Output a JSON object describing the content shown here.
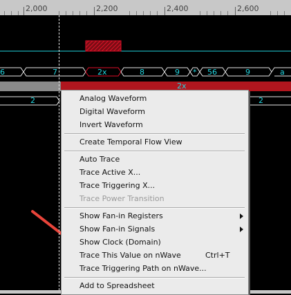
{
  "ruler": {
    "labels": [
      "2,000",
      "2,200",
      "2,400",
      "2,600"
    ]
  },
  "signals": {
    "bus1_values": [
      "6",
      "7",
      "2x",
      "8",
      "9",
      "*",
      "56",
      "9",
      "a"
    ],
    "bus2_label": "2x",
    "bus3_values": [
      "2",
      "2"
    ]
  },
  "menu": {
    "items": [
      {
        "label": "Analog Waveform"
      },
      {
        "label": "Digital Waveform"
      },
      {
        "label": "Invert Waveform"
      },
      {
        "label": "Create Temporal Flow View"
      },
      {
        "label": "Auto Trace"
      },
      {
        "label": "Trace Active X..."
      },
      {
        "label": "Trace Triggering X..."
      },
      {
        "label": "Trace Power Transition",
        "disabled": true
      },
      {
        "label": "Show Fan-in Registers",
        "submenu": true
      },
      {
        "label": "Show Fan-in Signals",
        "submenu": true
      },
      {
        "label": "Show Clock (Domain)"
      },
      {
        "label": "Trace This Value on nWave",
        "shortcut": "Ctrl+T"
      },
      {
        "label": "Trace Triggering Path on nWave..."
      },
      {
        "label": "Add to Spreadsheet"
      }
    ]
  },
  "colors": {
    "waveform": "#22d6e0",
    "highlight": "#e0102a",
    "annotation_arrow": "#e8443a",
    "cursor": "#e6e6e6"
  }
}
